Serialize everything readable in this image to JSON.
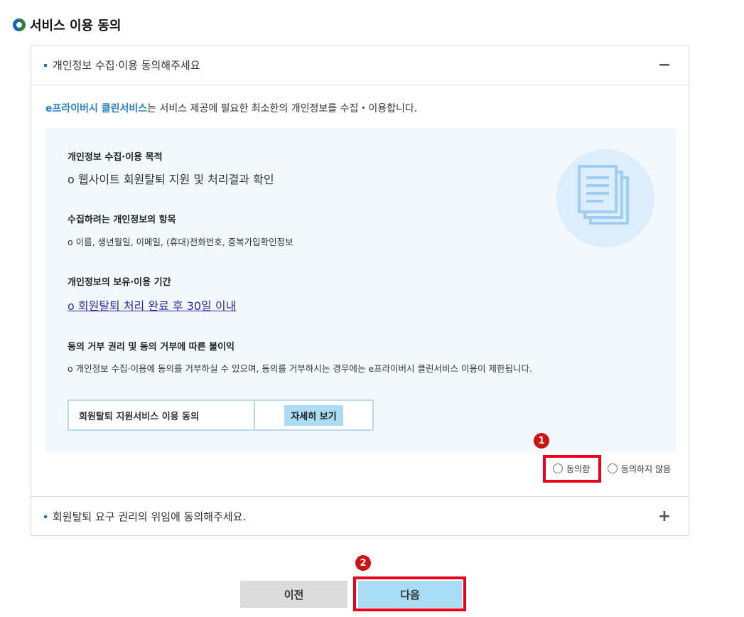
{
  "page": {
    "title": "서비스 이용 동의"
  },
  "sections": [
    {
      "title": "개인정보 수집·이용 동의해주세요",
      "toggle": "−"
    },
    {
      "title": "회원탈퇴 요구 권리의 위임에 동의해주세요.",
      "toggle": "+"
    }
  ],
  "intro": {
    "brand": "e프라이버시 클린서비스",
    "text": "는 서비스 제공에 필요한 최소한의 개인정보를 수집・이용합니다."
  },
  "info": {
    "purpose_label": "개인정보 수집·이용 목적",
    "purpose_value": "o 웹사이트 회원탈퇴 지원 및 처리결과 확인",
    "items_label": "수집하려는 개인정보의 항목",
    "items_value": "o 이름, 생년월일, 이메일, (휴대)전화번호, 중복가입확인정보",
    "period_label": "개인정보의 보유·이용 기간",
    "period_value": "o 회원탈퇴 처리 완료 후 30일 이내",
    "refuse_label": "동의 거부 권리 및 동의 거부에 따른 불이익",
    "refuse_value": "o 개인정보 수집·이용에 동의를 거부하실 수 있으며, 동의를 거부하시는 경우에는 e프라이버시 클린서비스 이용이 제한됩니다."
  },
  "detail": {
    "label": "회원탈퇴 지원서비스 이용 동의",
    "button": "자세히 보기"
  },
  "consent": {
    "agree": "동의함",
    "disagree": "동의하지 않음"
  },
  "steps": [
    "❶",
    "❷"
  ],
  "buttons": {
    "prev": "이전",
    "next": "다음"
  },
  "colors": {
    "accent": "#aadcf5",
    "highlight": "#e8001c",
    "brand": "#2a7fc9"
  },
  "icons": {
    "title": "circle-bullet-icon",
    "illustration": "document-stack-icon"
  }
}
